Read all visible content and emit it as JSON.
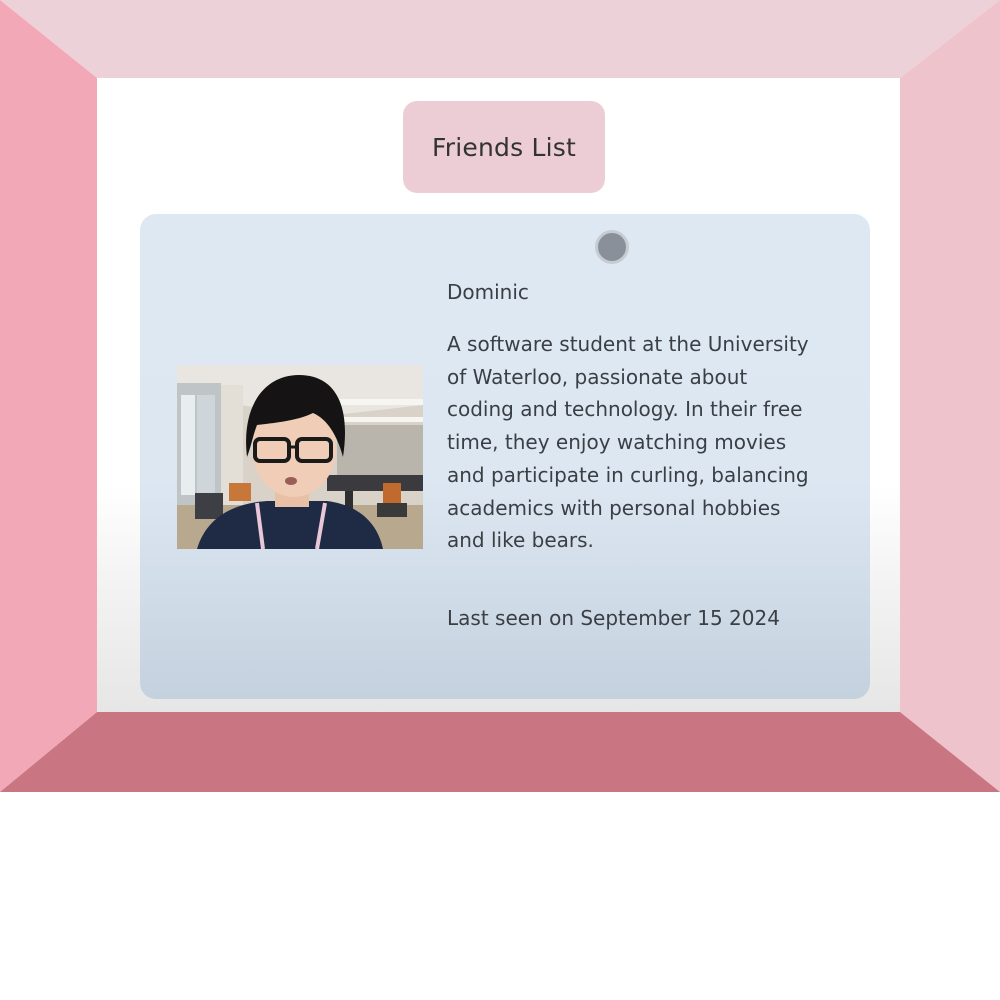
{
  "header": {
    "title": "Friends List"
  },
  "friend": {
    "name": "Dominic",
    "bio": "A software student at the University of Waterloo, passionate about coding and technology. In their free time, they enjoy watching movies and participate in curling, balancing academics with personal hobbies and like bears.",
    "last_seen": "Last seen on September 15 2024"
  },
  "colors": {
    "frame_top": "#edd1d8",
    "frame_left": "#f2a8b7",
    "frame_right": "#eec3cc",
    "frame_bottom": "#c97682",
    "title_pill": "#eccdd5",
    "card": "#dde8f3",
    "pin": "#8a9099"
  }
}
